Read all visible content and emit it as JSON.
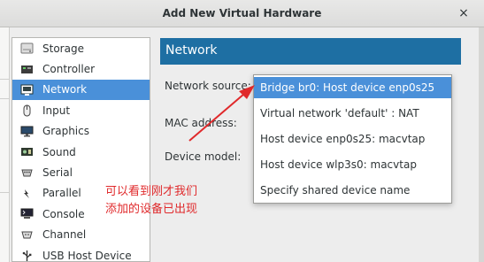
{
  "window": {
    "title": "Add New Virtual Hardware",
    "close_label": "×"
  },
  "sidebar": {
    "items": [
      {
        "label": "Storage",
        "icon": "storage-icon"
      },
      {
        "label": "Controller",
        "icon": "controller-icon"
      },
      {
        "label": "Network",
        "icon": "network-icon"
      },
      {
        "label": "Input",
        "icon": "mouse-icon"
      },
      {
        "label": "Graphics",
        "icon": "monitor-icon"
      },
      {
        "label": "Sound",
        "icon": "sound-card-icon"
      },
      {
        "label": "Serial",
        "icon": "serial-port-icon"
      },
      {
        "label": "Parallel",
        "icon": "parallel-port-icon"
      },
      {
        "label": "Console",
        "icon": "console-icon"
      },
      {
        "label": "Channel",
        "icon": "channel-icon"
      },
      {
        "label": "USB Host Device",
        "icon": "usb-icon"
      }
    ],
    "selected_index": 2
  },
  "main": {
    "header": "Network",
    "network_source_label": "Network source:",
    "mac_address_label": "MAC address:",
    "device_model_label": "Device model:"
  },
  "dropdown": {
    "options": [
      "Bridge br0: Host device enp0s25",
      "Virtual network 'default' : NAT",
      "Host device enp0s25: macvtap",
      "Host device wlp3s0: macvtap",
      "Specify shared device name"
    ],
    "selected_index": 0
  },
  "annotation": {
    "line1": "可以看到刚才我们",
    "line2": "添加的设备已出现",
    "color": "#e0292b"
  },
  "colors": {
    "accent": "#4a90d9",
    "header": "#1e6fa3"
  }
}
